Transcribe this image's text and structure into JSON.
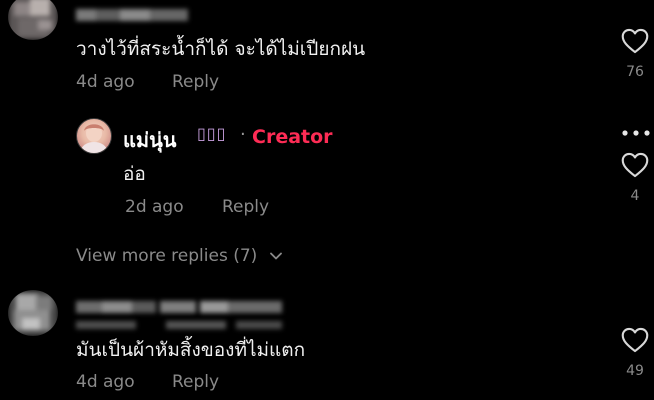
{
  "comments": [
    {
      "text": "วางไว้ที่สระน้ำก็ได้ จะได้ไม่เปียกฝน",
      "time": "4d ago",
      "reply_label": "Reply",
      "likes": "76"
    },
    {
      "text": "มันเป็นผ้าหัมสิ้งของที่ไม่แตก",
      "time": "4d ago",
      "reply_label": "Reply",
      "likes": "49"
    }
  ],
  "creator_reply": {
    "name": "แม่นุ่น",
    "name_icons": "▯▯▯",
    "separator": "·",
    "creator_label": "Creator",
    "text": "อ่อ",
    "time": "2d ago",
    "reply_label": "Reply",
    "likes": "4"
  },
  "view_more": {
    "label": "View more replies (7)"
  },
  "icons": {
    "like": "heart-outline-icon",
    "more": "more-options-icon",
    "chevron": "chevron-down-icon"
  },
  "colors": {
    "background": "#000000",
    "creator_accent": "#fe2c55",
    "muted": "#8a8a8a"
  }
}
